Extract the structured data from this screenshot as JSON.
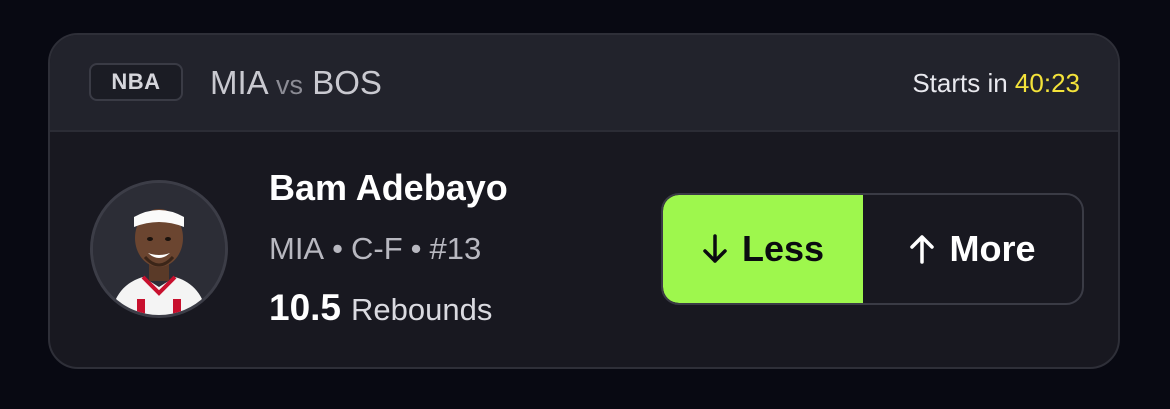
{
  "header": {
    "league": "NBA",
    "home_team": "MIA",
    "vs_label": "vs",
    "away_team": "BOS",
    "starts_label": "Starts in",
    "countdown": "40:23"
  },
  "player": {
    "name": "Bam Adebayo",
    "team": "MIA",
    "position": "C-F",
    "number": "#13",
    "meta_separator": "•",
    "line_value": "10.5",
    "stat": "Rebounds"
  },
  "pick": {
    "less_label": "Less",
    "more_label": "More",
    "selected": "less"
  },
  "colors": {
    "accent_green": "#9ef74d",
    "countdown_yellow": "#f3e23a"
  },
  "icons": {
    "less": "arrow-down-icon",
    "more": "arrow-up-icon"
  }
}
